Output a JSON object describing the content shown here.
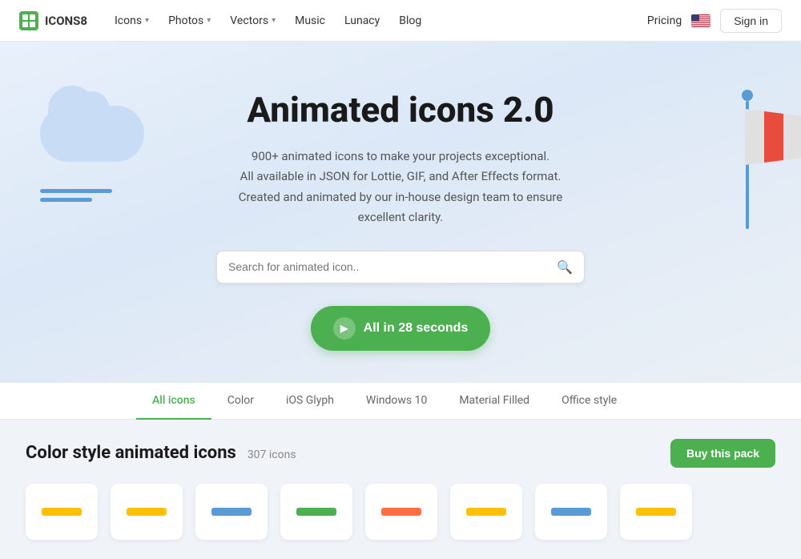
{
  "brand": {
    "name": "ICONS8"
  },
  "nav": {
    "links": [
      {
        "label": "Icons",
        "hasDropdown": true
      },
      {
        "label": "Photos",
        "hasDropdown": true
      },
      {
        "label": "Vectors",
        "hasDropdown": true
      },
      {
        "label": "Music",
        "hasDropdown": false
      },
      {
        "label": "Lunacy",
        "hasDropdown": false
      },
      {
        "label": "Blog",
        "hasDropdown": false
      }
    ],
    "pricing_label": "Pricing",
    "sign_in_label": "Sign in"
  },
  "hero": {
    "title": "Animated icons 2.0",
    "description_line1": "900+ animated icons to make your projects exceptional.",
    "description_line2": "All available in JSON for Lottie, GIF, and After Effects format.",
    "description_line3": "Created and animated by our in-house design team to ensure excellent clarity.",
    "search_placeholder": "Search for animated icon..",
    "cta_label": "All in 28 seconds",
    "cta_time": "28 seconds"
  },
  "tabs": [
    {
      "label": "All icons",
      "active": true
    },
    {
      "label": "Color",
      "active": false
    },
    {
      "label": "iOS Glyph",
      "active": false
    },
    {
      "label": "Windows 10",
      "active": false
    },
    {
      "label": "Material Filled",
      "active": false
    },
    {
      "label": "Office style",
      "active": false
    }
  ],
  "pack": {
    "title": "Color style animated icons",
    "count": "307 icons",
    "buy_label": "Buy this pack"
  }
}
